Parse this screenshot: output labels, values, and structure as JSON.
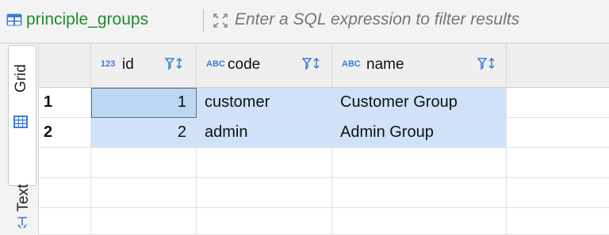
{
  "toolbar": {
    "table_name": "principle_groups",
    "filter_placeholder": "Enter a SQL expression to filter results"
  },
  "side_tabs": {
    "grid_label": "Grid",
    "text_label": "Text"
  },
  "columns": [
    {
      "type_badge": "123",
      "label": "id"
    },
    {
      "type_badge": "ABC",
      "label": "code"
    },
    {
      "type_badge": "ABC",
      "label": "name"
    }
  ],
  "rows": [
    {
      "num": "1",
      "id": "1",
      "code": "customer",
      "name": "Customer Group"
    },
    {
      "num": "2",
      "id": "2",
      "code": "admin",
      "name": "Admin Group"
    }
  ],
  "colors": {
    "table_name": "#1f8c2f",
    "selection": "#cfe2f9",
    "selection_active": "#bcd8f5",
    "accent_icon": "#3e7bd6"
  },
  "icons": [
    "table-icon",
    "expand-icon",
    "grid-icon",
    "text-icon",
    "filter-sort-icon"
  ]
}
